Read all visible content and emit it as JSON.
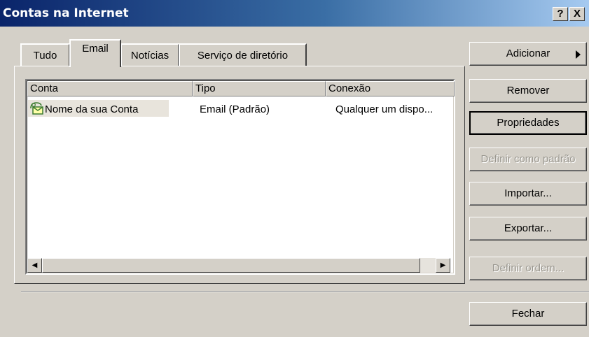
{
  "window": {
    "title": "Contas na Internet",
    "help_label": "?",
    "close_label": "X"
  },
  "tabs": [
    {
      "label": "Tudo",
      "active": false
    },
    {
      "label": "Email",
      "active": true
    },
    {
      "label": "Notícias",
      "active": false
    },
    {
      "label": "Serviço de diretório",
      "active": false
    }
  ],
  "list": {
    "columns": [
      "Conta",
      "Tipo",
      "Conexão"
    ],
    "rows": [
      {
        "conta": "Nome da sua Conta",
        "tipo": "Email (Padrão)",
        "conexao": "Qualquer um dispo..."
      }
    ],
    "row_icon": "mail-account-icon"
  },
  "buttons": {
    "adicionar": "Adicionar",
    "remover": "Remover",
    "propriedades": "Propriedades",
    "definir_padrao": "Definir como padrão",
    "importar": "Importar...",
    "exportar": "Exportar...",
    "definir_ordem": "Definir ordem...",
    "fechar": "Fechar"
  },
  "colors": {
    "face": "#d4d0c8",
    "title_start": "#0a246a",
    "title_end": "#a6caf0"
  }
}
